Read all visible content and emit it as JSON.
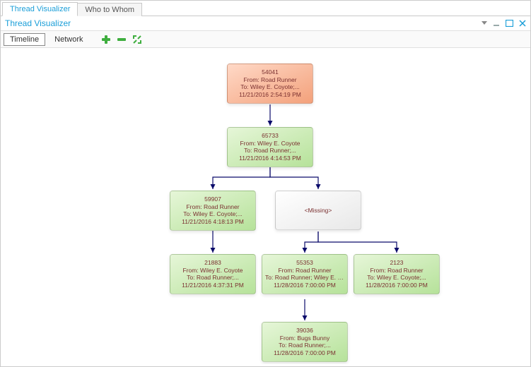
{
  "tabs": {
    "main": "Thread Visualizer",
    "alt": "Who to Whom"
  },
  "panel_title": "Thread Visualizer",
  "toolbar": {
    "timeline": "Timeline",
    "network": "Network"
  },
  "nodes": {
    "n1": {
      "id": "54041",
      "from": "From: Road Runner",
      "to": "To: Wiley E. Coyote;...",
      "ts": "11/21/2016 2:54:19 PM"
    },
    "n2": {
      "id": "65733",
      "from": "From: Wiley E. Coyote",
      "to": "To: Road Runner;...",
      "ts": "11/21/2016 4:14:53 PM"
    },
    "n3": {
      "id": "59907",
      "from": "From: Road Runner",
      "to": "To: Wiley E. Coyote;...",
      "ts": "11/21/2016 4:18:13 PM"
    },
    "n4": {
      "label": "<Missing>"
    },
    "n5": {
      "id": "21883",
      "from": "From: Wiley E. Coyote",
      "to": "To: Road Runner;...",
      "ts": "11/21/2016 4:37:31 PM"
    },
    "n6": {
      "id": "55353",
      "from": "From: Road Runner",
      "to": "To: Road Runner; Wiley E. Coyote;...",
      "ts": "11/28/2016 7:00:00 PM"
    },
    "n7": {
      "id": "2123",
      "from": "From: Road Runner",
      "to": "To: Wiley E. Coyote;...",
      "ts": "11/28/2016 7:00:00 PM"
    },
    "n8": {
      "id": "39036",
      "from": "From: Bugs Bunny",
      "to": "To: Road Runner;...",
      "ts": "11/28/2016 7:00:00 PM"
    }
  }
}
